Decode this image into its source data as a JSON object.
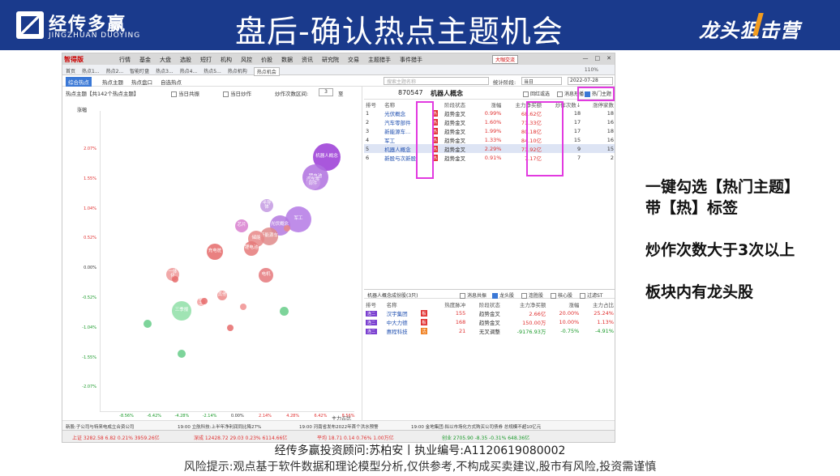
{
  "header": {
    "logo_cn": "经传多赢",
    "logo_en": "JINGZHUAN DUOYING",
    "title": "盘后-确认热点主题机会",
    "slogan": "龙头狙击营"
  },
  "app": {
    "brand": "智得版",
    "menu": [
      "行情",
      "基金",
      "大盘",
      "选股",
      "短打",
      "机构",
      "风控",
      "价股",
      "数据",
      "资讯",
      "研究院",
      "交易",
      "主题猎手",
      "事件猎手"
    ],
    "topright_btn": "大咖交流",
    "nav": [
      "首页",
      "热点1...",
      "热点2...",
      "智能盯盘",
      "热点3...",
      "热点4...",
      "热点5...",
      "热点机构",
      "热点机会"
    ],
    "zoom": "110%",
    "subtabs": [
      "综合热点",
      "热点主题",
      "热点盘口",
      "自选热点"
    ],
    "search_placeholder": "搜索主题名称",
    "stat_label": "统计阶段:",
    "stat_value": "当日",
    "date_value": "2022-07-28",
    "left_top": {
      "title": "热点主题【共142个热点主题】",
      "chk1": "当日共振",
      "chk2": "当日炒作",
      "range_label": "炒作次数区间:",
      "range_from": "3",
      "range_to": "至"
    },
    "y_axis_label": "涨幅",
    "x_axis_label": "主力占比",
    "y_ticks": [
      "2.07%",
      "1.55%",
      "1.04%",
      "0.52%",
      "0.00%",
      "-0.52%",
      "-1.04%",
      "-1.55%",
      "-2.07%"
    ],
    "x_ticks": [
      "-8.56%",
      "-6.42%",
      "-4.28%",
      "-2.14%",
      "0.00%",
      "2.14%",
      "4.28%",
      "6.42%",
      "8.56%"
    ],
    "bubbles": [
      {
        "label": "机器人概念",
        "color": "#9b3ad6"
      },
      {
        "label": "锂电池",
        "color": "#b070e0"
      },
      {
        "label": "军工",
        "color": "#b57ae6"
      },
      {
        "label": "光伏概念",
        "color": "#b47ae0"
      },
      {
        "label": "汽车零部件",
        "color": "#c89ae8"
      },
      {
        "label": "新能源车",
        "color": "#e08a8a"
      },
      {
        "label": "储能",
        "color": "#e88888"
      },
      {
        "label": "锂电池",
        "color": "#e67a7a"
      },
      {
        "label": "充电桩",
        "color": "#e66b6b"
      },
      {
        "label": "芯片",
        "color": "#d97fd0"
      },
      {
        "label": "半导体",
        "color": "#c49ae2"
      },
      {
        "label": "电机",
        "color": "#e6787c"
      },
      {
        "label": "其他",
        "color": "#ee8a8a"
      },
      {
        "label": "一体化",
        "color": "#ef9a9a"
      },
      {
        "label": "稀土",
        "color": "#f4a0a0"
      },
      {
        "label": "三季报",
        "color": "#90e0a8"
      }
    ],
    "right": {
      "code": "870547",
      "name": "机器人概念",
      "chk_a": "回红或选",
      "chk_b": "消息形播",
      "chk_c": "热门主题",
      "headers": [
        "排号",
        "名称",
        "",
        "阶段状态",
        "涨幅",
        "主力净买额",
        "炒作次数↓",
        "涨停家数"
      ],
      "rows": [
        {
          "no": "1",
          "name": "光伏概念",
          "hot": "热",
          "stage": "趋势金叉",
          "pct": "0.99%",
          "net": "68.62亿",
          "times": "18",
          "limit": "18"
        },
        {
          "no": "2",
          "name": "汽车零部件",
          "hot": "热",
          "stage": "趋势金叉",
          "pct": "1.60%",
          "net": "71.33亿",
          "times": "17",
          "limit": "16"
        },
        {
          "no": "3",
          "name": "新能源车...",
          "hot": "热",
          "stage": "趋势金叉",
          "pct": "1.99%",
          "net": "80.18亿",
          "times": "17",
          "limit": "18"
        },
        {
          "no": "4",
          "name": "军工",
          "hot": "热",
          "stage": "趋势金叉",
          "pct": "1.33%",
          "net": "84.10亿",
          "times": "15",
          "limit": "16"
        },
        {
          "no": "5",
          "name": "机器人概念",
          "hot": "热",
          "stage": "趋势金叉",
          "pct": "2.29%",
          "net": "71.92亿",
          "times": "9",
          "limit": "15"
        },
        {
          "no": "6",
          "name": "新股与次新股",
          "hot": "热",
          "stage": "趋势金叉",
          "pct": "0.91%",
          "net": "7.17亿",
          "times": "7",
          "limit": "2"
        }
      ],
      "sub_title": "机器人概念成份股(3只)",
      "sub_chks": [
        "消息共振",
        "龙头股",
        "连胜股",
        "核心股",
        "过滤ST"
      ],
      "sub_headers": [
        "排号",
        "名称",
        "",
        "热度脉冲",
        "阶段状态",
        "主力净买额",
        "涨幅",
        "主力占比"
      ],
      "sub_rows": [
        {
          "tag": "连二",
          "name": "汉宇集团",
          "flag": "板",
          "heat": "155",
          "stage": "趋势金叉",
          "net": "2.66亿",
          "pct": "20.00%",
          "ratio": "25.24%",
          "flagcolor": "red"
        },
        {
          "tag": "连二",
          "name": "中大力德",
          "flag": "板",
          "heat": "168",
          "stage": "趋势金叉",
          "net": "150.00万",
          "pct": "10.00%",
          "ratio": "1.13%",
          "flagcolor": "red"
        },
        {
          "tag": "连二",
          "name": "惠程科技",
          "flag": "活",
          "heat": "21",
          "stage": "无叉调整",
          "net": "-9176.93万",
          "pct": "-0.75%",
          "ratio": "-4.91%",
          "flagcolor": "orange"
        }
      ]
    },
    "news": [
      "新股:子公司与特来电成立合资公司",
      "19:00 立航科技:上半年净利润同比降27%",
      "19:00 河南省发布2022年首个洪水预警",
      "19:00 金地集团:拟以市场化方式购买公司债券 总规模不超10亿元"
    ],
    "status": [
      "上证 3282.58 6.82 0.21% 3959.26亿",
      "深成 12428.72 29.03 0.23% 6114.66亿",
      "平均 18.71 0.14 0.76% 1.00万亿",
      "创业 2705.90 -8.35 -0.31% 648.36亿"
    ]
  },
  "annotations": [
    "一键勾选【热门主题】",
    "带【热】标签",
    "炒作次数大于3次以上",
    "板块内有龙头股"
  ],
  "footer": {
    "line1": "经传多赢投资顾问:苏柏安丨执业编号:A1120619080002",
    "line2": "风险提示:观点基于软件数据和理论模型分析,仅供参考,不构成买卖建议,股市有风险,投资需谨慎"
  }
}
